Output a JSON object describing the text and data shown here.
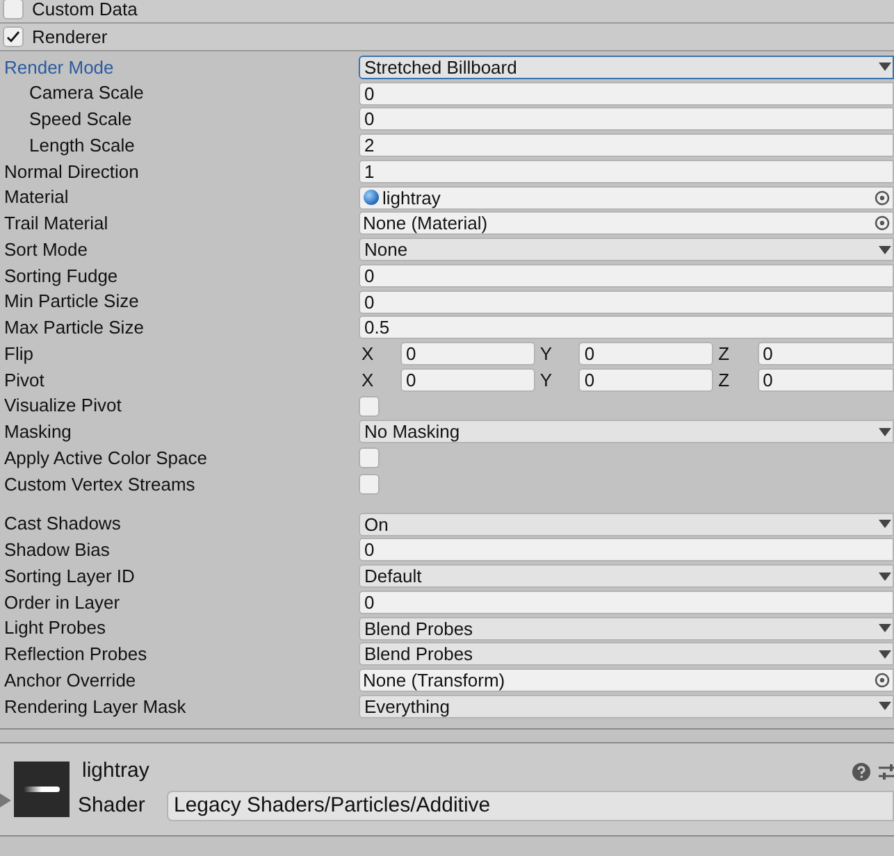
{
  "modules": [
    {
      "label": "Custom Data",
      "checked": false
    },
    {
      "label": "Renderer",
      "checked": true
    }
  ],
  "groups": [
    [
      {
        "kind": "dropdown",
        "label": "Render Mode",
        "value": "Stretched Billboard",
        "focused": true,
        "children": [
          {
            "kind": "number",
            "label": "Camera Scale",
            "value": "0"
          },
          {
            "kind": "number",
            "label": "Speed Scale",
            "value": "0"
          },
          {
            "kind": "number",
            "label": "Length Scale",
            "value": "2"
          }
        ]
      },
      {
        "kind": "number",
        "label": "Normal Direction",
        "value": "1"
      },
      {
        "kind": "asset",
        "label": "Material",
        "value": "lightray"
      },
      {
        "kind": "object",
        "label": "Trail Material",
        "value": "None (Material)"
      },
      {
        "kind": "dropdown",
        "label": "Sort Mode",
        "value": "None"
      },
      {
        "kind": "number",
        "label": "Sorting Fudge",
        "value": "0"
      },
      {
        "kind": "number",
        "label": "Min Particle Size",
        "value": "0"
      },
      {
        "kind": "number",
        "label": "Max Particle Size",
        "value": "0.5"
      },
      {
        "kind": "vector",
        "label": "Flip",
        "axes": [
          {
            "axis": "X",
            "value": "0"
          },
          {
            "axis": "Y",
            "value": "0"
          },
          {
            "axis": "Z",
            "value": "0"
          }
        ]
      },
      {
        "kind": "vector",
        "label": "Pivot",
        "axes": [
          {
            "axis": "X",
            "value": "0"
          },
          {
            "axis": "Y",
            "value": "0"
          },
          {
            "axis": "Z",
            "value": "0"
          }
        ]
      },
      {
        "kind": "checkbox",
        "label": "Visualize Pivot",
        "checked": false
      },
      {
        "kind": "dropdown",
        "label": "Masking",
        "value": "No Masking"
      },
      {
        "kind": "checkbox",
        "label": "Apply Active Color Space",
        "checked": false
      },
      {
        "kind": "checkbox",
        "label": "Custom Vertex Streams",
        "checked": false
      }
    ],
    [
      {
        "kind": "dropdown",
        "label": "Cast Shadows",
        "value": "On"
      },
      {
        "kind": "number",
        "label": "Shadow Bias",
        "value": "0"
      },
      {
        "kind": "dropdown",
        "label": "Sorting Layer ID",
        "value": "Default"
      },
      {
        "kind": "number",
        "label": "Order in Layer",
        "value": "0"
      },
      {
        "kind": "dropdown",
        "label": "Light Probes",
        "value": "Blend Probes"
      },
      {
        "kind": "dropdown",
        "label": "Reflection Probes",
        "value": "Blend Probes"
      },
      {
        "kind": "object",
        "label": "Anchor Override",
        "value": "None (Transform)"
      },
      {
        "kind": "dropdown",
        "label": "Rendering Layer Mask",
        "value": "Everything"
      }
    ]
  ],
  "material": {
    "name": "lightray",
    "shader_label": "Shader",
    "shader": "Legacy Shaders/Particles/Additive"
  }
}
